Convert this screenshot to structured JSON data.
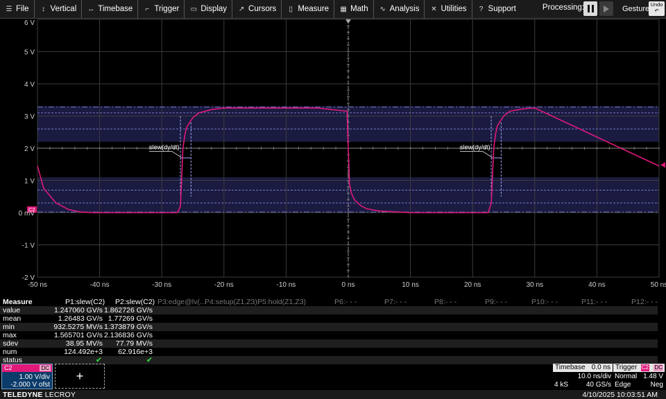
{
  "menu": [
    {
      "icon": "file-icon",
      "glyph": "☰",
      "label": "File"
    },
    {
      "icon": "vertical-icon",
      "glyph": "↕",
      "label": "Vertical"
    },
    {
      "icon": "timebase-icon",
      "glyph": "↔",
      "label": "Timebase"
    },
    {
      "icon": "trigger-icon",
      "glyph": "⌐",
      "label": "Trigger"
    },
    {
      "icon": "display-icon",
      "glyph": "▭",
      "label": "Display"
    },
    {
      "icon": "cursors-icon",
      "glyph": "↗",
      "label": "Cursors"
    },
    {
      "icon": "measure-icon",
      "glyph": "▯",
      "label": "Measure"
    },
    {
      "icon": "math-icon",
      "glyph": "▦",
      "label": "Math"
    },
    {
      "icon": "analysis-icon",
      "glyph": "∿",
      "label": "Analysis"
    },
    {
      "icon": "utilities-icon",
      "glyph": "✕",
      "label": "Utilities"
    },
    {
      "icon": "support-icon",
      "glyph": "?",
      "label": "Support"
    }
  ],
  "toolbar": {
    "processing_label": "Processing:",
    "gesture_label": "Gesture",
    "undo_label": "Undo"
  },
  "grid": {
    "y_labels": [
      "6 V",
      "5 V",
      "4 V",
      "3 V",
      "2 V",
      "1 V",
      "0 mV",
      "-1 V",
      "-2 V"
    ],
    "x_labels": [
      "-50 ns",
      "-40 ns",
      "-30 ns",
      "-20 ns",
      "-10 ns",
      "0 ns",
      "10 ns",
      "20 ns",
      "30 ns",
      "40 ns",
      "50 ns"
    ],
    "trace_color": "#e0197a",
    "annotation_label": "slew(dy/dt)",
    "channel_marker": "C2"
  },
  "chart_data": {
    "type": "line",
    "x_unit": "ns",
    "y_unit": "V",
    "xlim": [
      -50,
      50
    ],
    "ylim": [
      -2,
      6
    ],
    "series": [
      {
        "name": "C2",
        "x": [
          -50,
          -49,
          -47,
          -45,
          -43,
          -41,
          -30,
          -27.5,
          -27,
          -26.6,
          -26.3,
          -26,
          -25,
          -24,
          -22,
          -20,
          -5,
          -0.2,
          0,
          0.2,
          0.5,
          1,
          2,
          3,
          5,
          8,
          10,
          20,
          22.5,
          23,
          23.4,
          23.7,
          24,
          25,
          26,
          28,
          30,
          50
        ],
        "y": [
          1.45,
          0.75,
          0.3,
          0.1,
          0.02,
          0,
          0,
          0,
          0.2,
          2.0,
          2.4,
          2.65,
          2.95,
          3.1,
          3.2,
          3.25,
          3.25,
          3.15,
          2.0,
          0.9,
          0.6,
          0.4,
          0.22,
          0.12,
          0.05,
          0.02,
          0,
          0,
          0,
          0.3,
          2.0,
          2.45,
          2.7,
          3.0,
          3.15,
          3.22,
          3.25,
          1.45
        ]
      }
    ],
    "grid": true
  },
  "measure": {
    "header": [
      "Measure",
      "P1:slew(C2)",
      "P2:slew(C2)",
      "P3:edge@lv(...",
      "P4:setup(Z1,Z3)",
      "P5:hold(Z1,Z3)",
      "P6:- - -",
      "P7:- - -",
      "P8:- - -",
      "P9:- - -",
      "P10:- - -",
      "P11:- - -",
      "P12:- - -"
    ],
    "rows": [
      {
        "label": "value",
        "p1": "1.247060 GV/s",
        "p2": "1.862726 GV/s"
      },
      {
        "label": "mean",
        "p1": "1.26483 GV/s",
        "p2": "1.77269 GV/s"
      },
      {
        "label": "min",
        "p1": "932.5275 MV/s",
        "p2": "1.373879 GV/s"
      },
      {
        "label": "max",
        "p1": "1.565701 GV/s",
        "p2": "2.136836 GV/s"
      },
      {
        "label": "sdev",
        "p1": "38.95 MV/s",
        "p2": "77.79 MV/s"
      },
      {
        "label": "num",
        "p1": "124.492e+3",
        "p2": "62.916e+3"
      },
      {
        "label": "status",
        "p1": "✔",
        "p2": "✔"
      }
    ]
  },
  "channel": {
    "name": "C2",
    "coupling": "DC",
    "vdiv": "1.00 V/div",
    "offset": "-2.000 V ofst"
  },
  "add_label": "+",
  "timebase": {
    "title": "Timebase",
    "delay": "0.0 ns",
    "tdiv": "10.0 ns/div",
    "samples": "4 kS",
    "rate": "40 GS/s"
  },
  "trigger": {
    "title": "Trigger",
    "ch": "C2",
    "cpl": "DC",
    "mode": "Normal",
    "level": "1.48 V",
    "type": "Edge",
    "slope": "Neg"
  },
  "footer": {
    "brand": "TELEDYNE",
    "brand2": " LECROY",
    "datetime": "4/10/2025 10:03:51 AM"
  }
}
